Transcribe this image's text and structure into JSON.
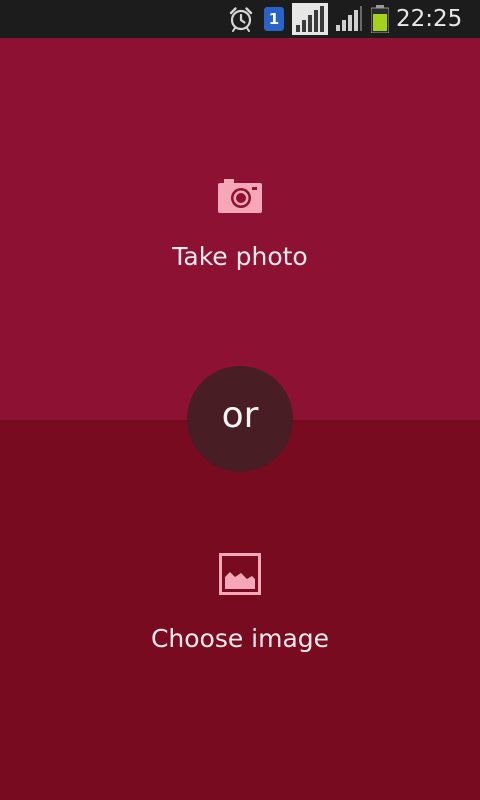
{
  "status_bar": {
    "time": "22:25",
    "sim_slot": "1",
    "icons": [
      "alarm-icon",
      "sim-card-icon",
      "signal-strength-icon",
      "signal-strength-icon",
      "battery-icon"
    ]
  },
  "actions": {
    "take_photo": {
      "label": "Take photo",
      "icon": "camera-icon"
    },
    "choose_image": {
      "label": "Choose image",
      "icon": "image-icon"
    },
    "separator": "or"
  },
  "colors": {
    "top_background": "#8c1132",
    "bottom_background": "#780b20",
    "separator_background": "#481d23",
    "icon_color": "#f6a7b7",
    "label_color": "#f7e8ec",
    "status_bar_background": "#1c1c1c"
  }
}
